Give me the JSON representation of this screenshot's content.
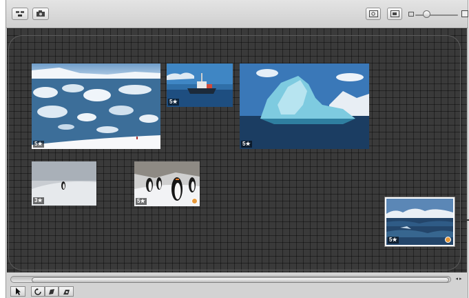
{
  "toolbar": {
    "left_buttons": [
      "stack-icon",
      "camera-icon"
    ],
    "right_buttons": [
      "zoom-to-fit-icon",
      "viewer-icon"
    ],
    "zoom_level": 0.17
  },
  "canvas": {
    "photos": [
      {
        "name": "iceberg-field",
        "rating": "5★",
        "selected": false,
        "has_badge": false
      },
      {
        "name": "ship",
        "rating": "5★",
        "selected": false,
        "has_badge": false
      },
      {
        "name": "blue-iceberg",
        "rating": "5★",
        "selected": false,
        "has_badge": false
      },
      {
        "name": "lone-penguin",
        "rating": "3★",
        "selected": false,
        "has_badge": false
      },
      {
        "name": "penguin-group",
        "rating": "5★",
        "selected": false,
        "has_badge": true
      },
      {
        "name": "stormy-sea",
        "rating": "5★",
        "selected": true,
        "has_badge": true
      }
    ]
  },
  "bottom_tools": [
    "pointer-tool-icon",
    "rotate-tool-icon",
    "flag-tool-icon",
    "color-label-tool-icon"
  ],
  "scroll_arrows": "◂▸",
  "colors": {
    "canvas_bg": "#3a3a3a",
    "badge": "#e89a3c"
  }
}
